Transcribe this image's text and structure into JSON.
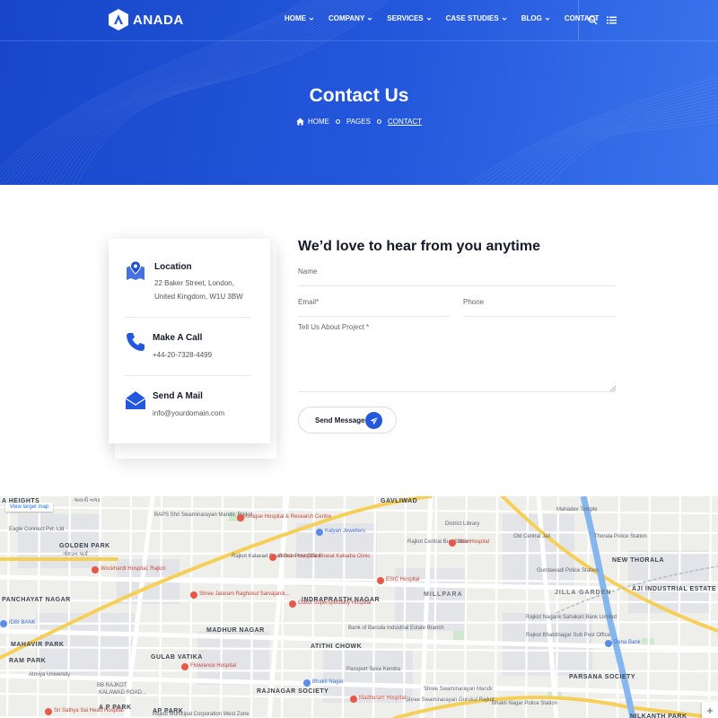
{
  "brand": {
    "logo_text": "ANADA"
  },
  "nav": {
    "items": [
      {
        "label": "HOME",
        "dropdown": true
      },
      {
        "label": "COMPANY",
        "dropdown": true
      },
      {
        "label": "SERVICES",
        "dropdown": true
      },
      {
        "label": "CASE STUDIES",
        "dropdown": true
      },
      {
        "label": "BLOG",
        "dropdown": true
      },
      {
        "label": "CONTACT",
        "dropdown": false
      }
    ],
    "icons": [
      "search-icon",
      "menu-list-icon"
    ]
  },
  "hero": {
    "title": "Contact Us",
    "breadcrumb": [
      "HOME",
      "PAGES",
      "CONTACT"
    ]
  },
  "info_card": {
    "location": {
      "title": "Location",
      "line1": "22 Baker Street, London,",
      "line2": "United Kingdom, W1U 3BW"
    },
    "call": {
      "title": "Make A Call",
      "text": "+44-20-7328-4499"
    },
    "mail": {
      "title": "Send A Mail",
      "text": "info@yourdomain.com"
    }
  },
  "form": {
    "title": "We’d love to hear from you anytime",
    "name_placeholder": "Name",
    "email_placeholder": "Email*",
    "phone_placeholder": "Phone",
    "project_placeholder": "Tell Us About Project *",
    "send_label": "Send Message"
  },
  "map": {
    "larger_map": "View larger map",
    "zoom_in": "+",
    "labels": [
      {
        "t": "A HEIGHTS",
        "k": "dark"
      },
      {
        "t": "ગાયત્રી નગર",
        "k": ""
      },
      {
        "t": "Eagle Connect Pvt. Ltd",
        "k": ""
      },
      {
        "t": "GOLDEN PARK",
        "k": "dark"
      },
      {
        "t": "ગોલ્ડન પાર્ક",
        "k": ""
      },
      {
        "t": "Wockhardt Hospital, Rajkot",
        "k": "red"
      },
      {
        "t": "PANCHAYAT NAGAR",
        "k": "dark"
      },
      {
        "t": "IDBI BANK",
        "k": "blue"
      },
      {
        "t": "MAHAVIR PARK",
        "k": "dark"
      },
      {
        "t": "RAM PARK",
        "k": "dark"
      },
      {
        "t": "GULAB VATIKA",
        "k": "dark"
      },
      {
        "t": "Atmiya University",
        "k": ""
      },
      {
        "t": "BB RAJKOT",
        "k": ""
      },
      {
        "t": "KALAWAD ROAD...",
        "k": ""
      },
      {
        "t": "Sri Sathya Sai Heart Hospital",
        "k": "red"
      },
      {
        "t": "A P PARK",
        "k": "dark"
      },
      {
        "t": "AP PARK",
        "k": "dark"
      },
      {
        "t": "Rajkot Municipal Corporation West Zone",
        "k": ""
      },
      {
        "t": "BAPS Shri Swaminarayan Mandir, Rajkot",
        "k": ""
      },
      {
        "t": "Unique Hospital & Research Centre",
        "k": "red"
      },
      {
        "t": "Rajkot Kalavad Road Sub Post Office",
        "k": ""
      },
      {
        "t": "Senses Hospital Bharat Kakadia Clinic",
        "k": "red"
      },
      {
        "t": "Shree Jalaram Raghukul Sarvajanik...",
        "k": "red"
      },
      {
        "t": "MADHUR NAGAR",
        "k": "dark"
      },
      {
        "t": "Flowrence Hospital",
        "k": "red"
      },
      {
        "t": "RAJNAGAR SOCIETY",
        "k": "dark"
      },
      {
        "t": "Kalyan Jewellers",
        "k": "blue"
      },
      {
        "t": "Gokul Superspeciality Hospital",
        "k": "red"
      },
      {
        "t": "INDRAPRASTH NAGAR",
        "k": "dark"
      },
      {
        "t": "ATITHI CHOWK",
        "k": "dark"
      },
      {
        "t": "Bhakti Nagar",
        "k": "blue"
      },
      {
        "t": "Madhuram Hospital",
        "k": "red"
      },
      {
        "t": "Shree Swaminarayan Gurukul Rajkot",
        "k": ""
      },
      {
        "t": "GAVLIWAD",
        "k": "dark"
      },
      {
        "t": "District Library",
        "k": ""
      },
      {
        "t": "Rajkot Central Bus Station",
        "k": ""
      },
      {
        "t": "Shiv Hospital",
        "k": "red"
      },
      {
        "t": "ESIC Hospital",
        "k": "red"
      },
      {
        "t": "MILLPARA",
        "k": "area"
      },
      {
        "t": "Bank of Baroda Industrial Estate Branch",
        "k": ""
      },
      {
        "t": "Passport Seva Kendra",
        "k": ""
      },
      {
        "t": "Shree Swaminarayan Mandir",
        "k": ""
      },
      {
        "t": "Mahadev Temple",
        "k": ""
      },
      {
        "t": "Old Central Jail",
        "k": ""
      },
      {
        "t": "Thorala Police Station",
        "k": ""
      },
      {
        "t": "Gundawadi Police Station",
        "k": ""
      },
      {
        "t": "NEW THORALA",
        "k": "dark"
      },
      {
        "t": "JILLA GARDEN",
        "k": "area"
      },
      {
        "t": "AJI INDUSTRIAL ESTATE",
        "k": "dark"
      },
      {
        "t": "Rajkot Nagarik Sahakari Bank Limited",
        "k": ""
      },
      {
        "t": "Rajkot Bhaktinagar Sub Post Office",
        "k": ""
      },
      {
        "t": "Dena Bank",
        "k": "blue"
      },
      {
        "t": "PARSANA SOCIETY",
        "k": "dark"
      },
      {
        "t": "Bhakti Nagar Police Station",
        "k": ""
      },
      {
        "t": "NILKANTH PARK",
        "k": "dark"
      }
    ]
  }
}
